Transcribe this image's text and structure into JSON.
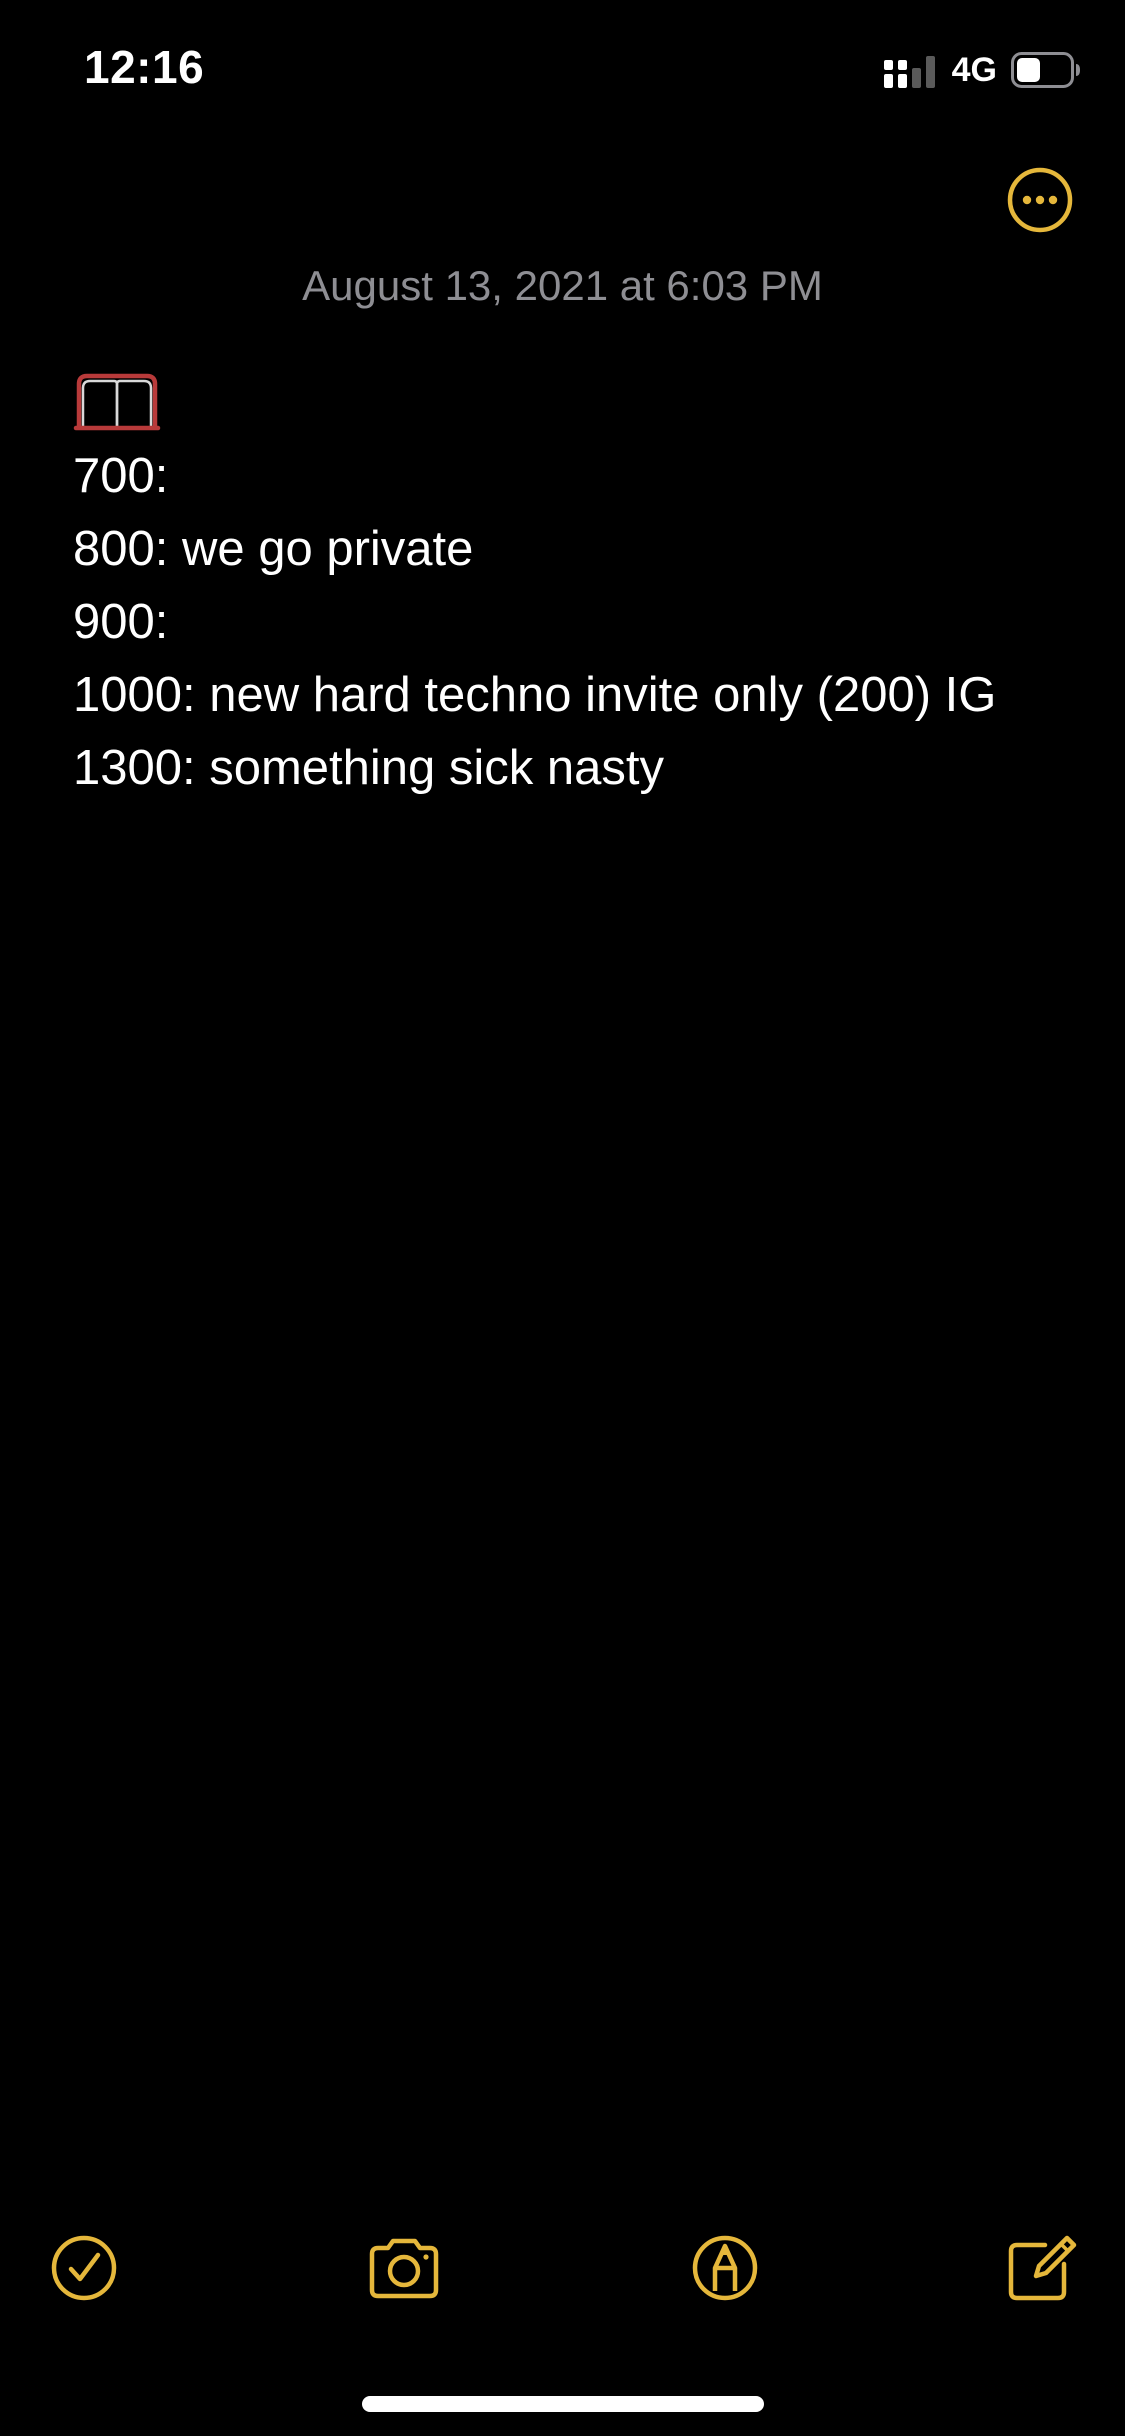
{
  "status_bar": {
    "time": "12:16",
    "network": "4G",
    "battery_level": 0.45
  },
  "colors": {
    "accent": "#E5B73B",
    "background": "#000000",
    "date_text": "#8E8E93",
    "body_text": "#FFFFFF",
    "emoji_red": "#B83A3A"
  },
  "header": {
    "more_icon": "ellipsis-circle-icon"
  },
  "note": {
    "date": "August 13, 2021 at 6:03 PM",
    "emoji": "open-book-icon",
    "lines": [
      "700:",
      "800: we go private",
      "900:",
      "1000: new hard techno invite only (200) IG",
      "1300: something sick nasty"
    ]
  },
  "toolbar": {
    "icons": [
      "checklist-icon",
      "camera-icon",
      "markup-icon",
      "compose-icon"
    ]
  }
}
